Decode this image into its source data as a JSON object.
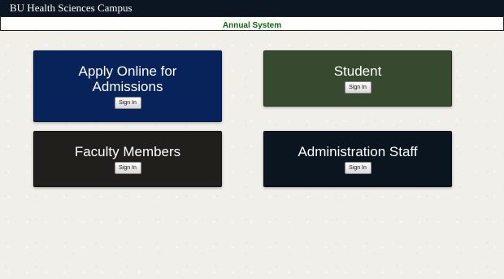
{
  "header": {
    "brand": "BU Health Sciences Campus",
    "subtitle": "Annual System"
  },
  "colors": {
    "topbar": "#0b1622",
    "subtitle_text": "#0a6b0a",
    "apply_tile": "#07235a",
    "student_tile": "#37492f",
    "faculty_tile": "#211f1b",
    "admin_tile": "#0b1520"
  },
  "tiles": {
    "apply": {
      "title": "Apply Online for Admissions",
      "button": "Sign In"
    },
    "student": {
      "title": "Student",
      "button": "Sign In"
    },
    "faculty": {
      "title": "Faculty Members",
      "button": "Sign In"
    },
    "admin": {
      "title": "Administration Staff",
      "button": "Sign In"
    }
  }
}
